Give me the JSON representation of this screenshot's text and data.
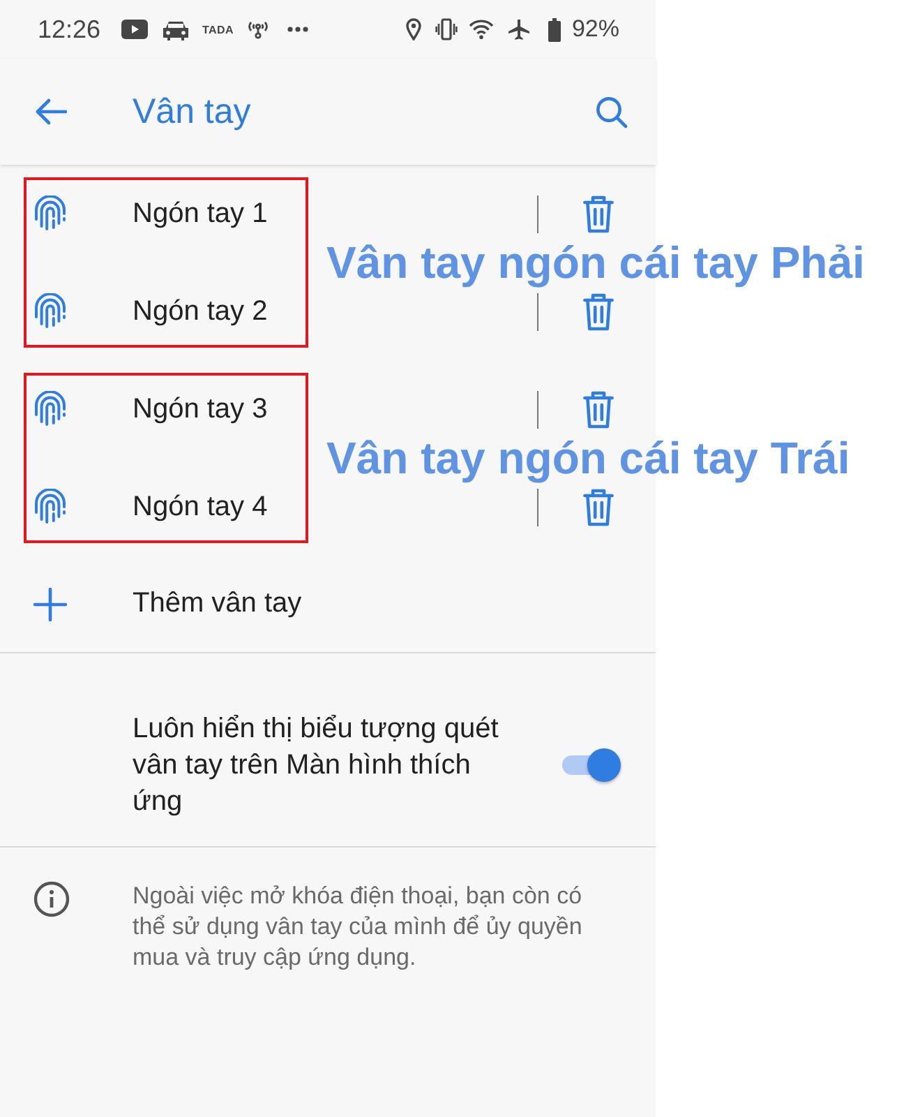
{
  "status_bar": {
    "time": "12:26",
    "app_label": "TADA",
    "battery_percent": "92%"
  },
  "app_bar": {
    "title": "Vân tay"
  },
  "fingerprint_groups": [
    {
      "annotation": "Vân tay ngón cái tay Phải",
      "fingerprints": [
        {
          "name": "Ngón tay 1"
        },
        {
          "name": "Ngón tay 2"
        }
      ]
    },
    {
      "annotation": "Vân tay ngón cái tay Trái",
      "fingerprints": [
        {
          "name": "Ngón tay 3"
        },
        {
          "name": "Ngón tay 4"
        }
      ]
    }
  ],
  "add_fingerprint": {
    "label": "Thêm vân tay"
  },
  "settings": [
    {
      "kind": "toggle",
      "label": "Luôn hiển thị biểu tượng quét vân tay trên Màn hình thích ứng",
      "on": true
    }
  ],
  "info": {
    "text": "Ngoài việc mở khóa điện thoại, bạn còn có thể sử dụng vân tay của mình để ủy quyền mua và truy cập ứng dụng."
  }
}
